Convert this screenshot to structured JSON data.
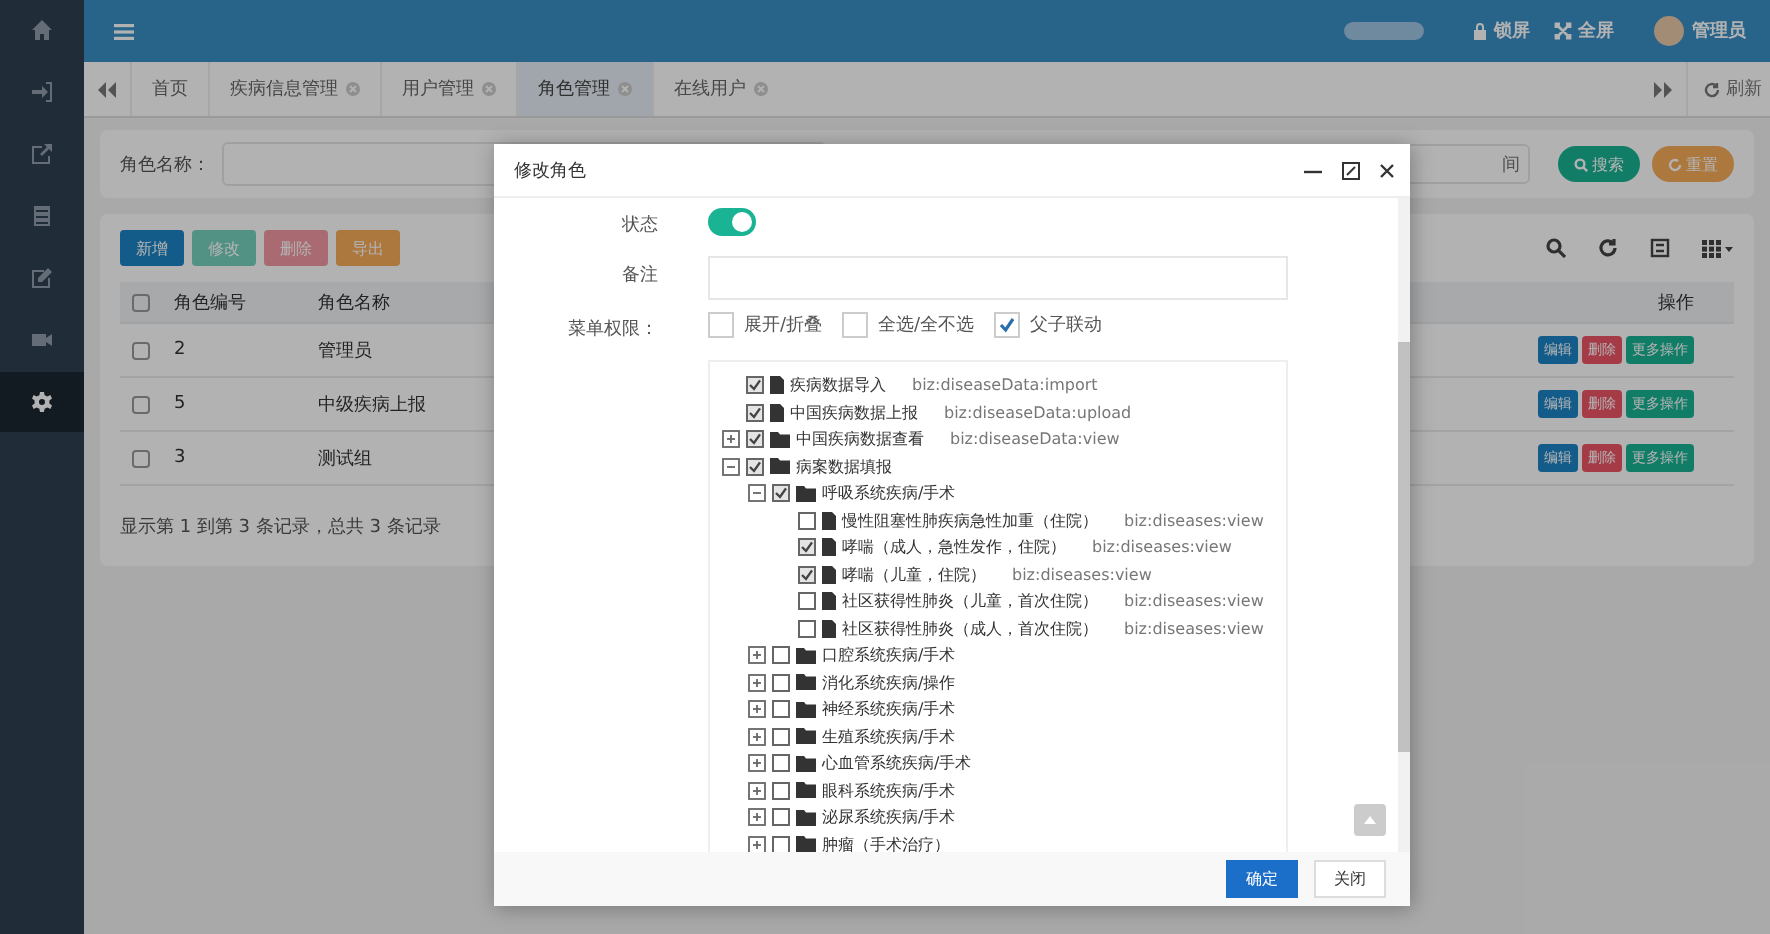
{
  "sidebar": {
    "items": [
      {
        "kind": "home",
        "selected": false
      },
      {
        "kind": "login",
        "selected": false
      },
      {
        "kind": "share",
        "selected": false
      },
      {
        "kind": "list",
        "selected": false
      },
      {
        "kind": "edit",
        "selected": false
      },
      {
        "kind": "video",
        "selected": false
      },
      {
        "kind": "gear",
        "selected": true
      }
    ]
  },
  "header": {
    "lock": "锁屏",
    "fullscreen": "全屏",
    "user": "管理员"
  },
  "tabs": [
    {
      "label": "首页",
      "selected": false,
      "closable": false
    },
    {
      "label": "疾病信息管理",
      "selected": false,
      "closable": true
    },
    {
      "label": "用户管理",
      "selected": false,
      "closable": true
    },
    {
      "label": "角色管理",
      "selected": true,
      "closable": true
    },
    {
      "label": "在线用户",
      "selected": false,
      "closable": true
    }
  ],
  "tab_bar": {
    "refresh": "刷新"
  },
  "search_form": {
    "label": "角色名称：",
    "date_placeholder": "间",
    "search": "搜索",
    "reset": "重置"
  },
  "toolbar": {
    "buttons": [
      {
        "kind": "add",
        "label": "新增",
        "disabled": false
      },
      {
        "kind": "edit",
        "label": "修改",
        "disabled": true
      },
      {
        "kind": "delete",
        "label": "删除",
        "disabled": true
      },
      {
        "kind": "export",
        "label": "导出",
        "disabled": false
      }
    ]
  },
  "table": {
    "select_all": false,
    "columns": [
      "角色编号",
      "角色名称",
      "操作"
    ],
    "rows": [
      {
        "selected": false,
        "cells": [
          "2",
          "管理员"
        ],
        "actions": [
          "编辑",
          "删除",
          "更多操作"
        ]
      },
      {
        "selected": false,
        "cells": [
          "5",
          "中级疾病上报"
        ],
        "actions": [
          "编辑",
          "删除",
          "更多操作"
        ]
      },
      {
        "selected": false,
        "cells": [
          "3",
          "测试组"
        ],
        "actions": [
          "编辑",
          "删除",
          "更多操作"
        ]
      }
    ],
    "footer": "显示第 1 到第 3 条记录，总共 3 条记录"
  },
  "dialog": {
    "title": "修改角色",
    "status": {
      "label": "状态",
      "on": true
    },
    "remark": {
      "label": "备注"
    },
    "menu": {
      "label": "菜单权限：",
      "options": [
        {
          "label": "展开/折叠",
          "checked": false
        },
        {
          "label": "全选/全不选",
          "checked": false
        },
        {
          "label": "父子联动",
          "checked": true
        }
      ]
    },
    "tree": [
      {
        "kind": "file",
        "label": "疾病数据导入",
        "perm": "biz:diseaseData:import",
        "checked": true
      },
      {
        "kind": "file",
        "label": "中国疾病数据上报",
        "perm": "biz:diseaseData:upload",
        "checked": true
      },
      {
        "kind": "folder",
        "label": "中国疾病数据查看",
        "perm": "biz:diseaseData:view",
        "checked": true,
        "expanded": false
      },
      {
        "kind": "folder",
        "label": "病案数据填报",
        "checked": true,
        "expanded": true,
        "children": [
          {
            "kind": "folder",
            "label": "呼吸系统疾病/手术",
            "checked": true,
            "expanded": true,
            "children": [
              {
                "kind": "file",
                "label": "慢性阻塞性肺疾病急性加重（住院）",
                "perm": "biz:diseases:view",
                "checked": false
              },
              {
                "kind": "file",
                "label": "哮喘（成人，急性发作，住院）",
                "perm": "biz:diseases:view",
                "checked": true
              },
              {
                "kind": "file",
                "label": "哮喘（儿童，住院）",
                "perm": "biz:diseases:view",
                "checked": true
              },
              {
                "kind": "file",
                "label": "社区获得性肺炎（儿童，首次住院）",
                "perm": "biz:diseases:view",
                "checked": false
              },
              {
                "kind": "file",
                "label": "社区获得性肺炎（成人，首次住院）",
                "perm": "biz:diseases:view",
                "checked": false
              }
            ]
          },
          {
            "kind": "folder",
            "label": "口腔系统疾病/手术",
            "checked": false,
            "expanded": false
          },
          {
            "kind": "folder",
            "label": "消化系统疾病/操作",
            "checked": false,
            "expanded": false
          },
          {
            "kind": "folder",
            "label": "神经系统疾病/手术",
            "checked": false,
            "expanded": false
          },
          {
            "kind": "folder",
            "label": "生殖系统疾病/手术",
            "checked": false,
            "expanded": false
          },
          {
            "kind": "folder",
            "label": "心血管系统疾病/手术",
            "checked": false,
            "expanded": false
          },
          {
            "kind": "folder",
            "label": "眼科系统疾病/手术",
            "checked": false,
            "expanded": false
          },
          {
            "kind": "folder",
            "label": "泌尿系统疾病/手术",
            "checked": false,
            "expanded": false
          },
          {
            "kind": "folder",
            "label": "肿瘤（手术治疗）",
            "checked": false,
            "expanded": false
          }
        ]
      }
    ],
    "buttons": [
      {
        "label": "确定",
        "primary": true
      },
      {
        "label": "关闭",
        "primary": false
      }
    ]
  }
}
